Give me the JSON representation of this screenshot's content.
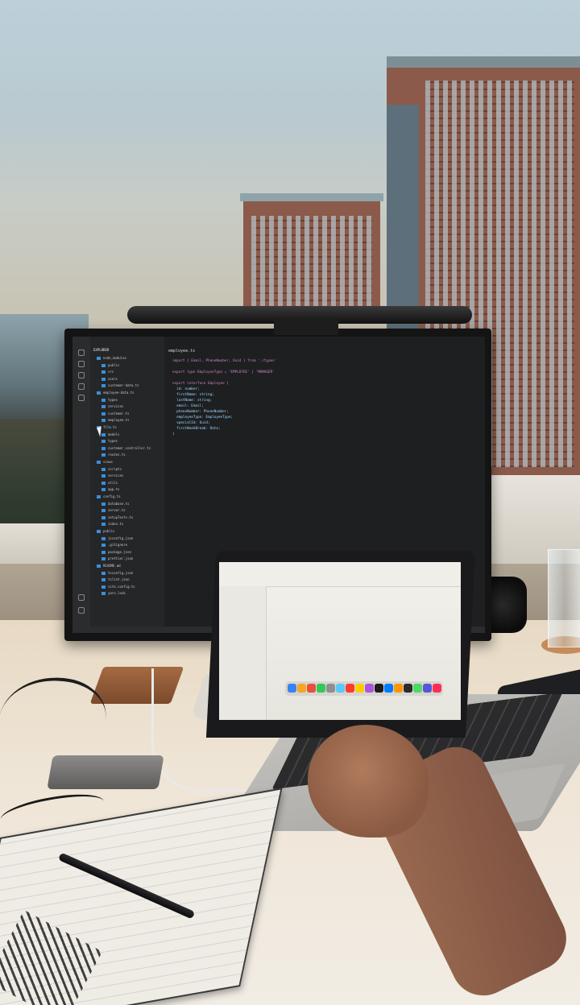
{
  "photo": {
    "subject": "desk-setup-with-monitor-laptop-city-view"
  },
  "monitor": {
    "editor": {
      "explorer_header": "EXPLORER",
      "tabs": [
        "employee.ts"
      ],
      "explorer_items": [
        "node_modules",
        "public",
        "src",
        "users",
        "customer-data.ts",
        "employee-data.ts",
        "types",
        "services",
        "customer.ts",
        "employee.ts",
        "file.ts",
        "models",
        "types",
        "customer.controller.ts",
        "routes.ts",
        "views",
        "scripts",
        "services",
        "utils",
        "app.ts",
        "config.ts",
        "database.ts",
        "server.ts",
        "setupTests.ts",
        "index.ts",
        "public",
        "jsconfig.json",
        ".gitignore",
        "package.json",
        "prettier.json",
        "README.md",
        "tsconfig.json",
        "tslint.json",
        "vite.config.ts",
        "yarn.lock"
      ],
      "code_lines": [
        "import { Email, PhoneNumber, Uuid } from './types'",
        "",
        "export type EmployeeType = 'EMPLOYEE' | 'MANAGER'",
        "",
        "export interface Employee {",
        "  id: number;",
        "  firstName: string;",
        "  lastName: string;",
        "  email: Email;",
        "  phoneNumber: PhoneNumber;",
        "  employeeType: EmployeeType;",
        "  specialId: Uuid;",
        "  firstWeekBreak: Date;",
        "}"
      ]
    }
  },
  "laptop": {
    "dock_colors": [
      "#3a82f7",
      "#f5a623",
      "#e94f3d",
      "#34c759",
      "#8e8e93",
      "#5ac8fa",
      "#ff3b30",
      "#ffcc00",
      "#af52de",
      "#1c1c1e",
      "#007aff",
      "#ff9500",
      "#2b2b2b",
      "#4cd964",
      "#5856d6",
      "#ff2d55"
    ]
  },
  "colors": {
    "sky": "#bcd0da",
    "desk": "#efe5d6",
    "editor_bg": "#1e1f21",
    "brick": "#8c5a4a"
  }
}
